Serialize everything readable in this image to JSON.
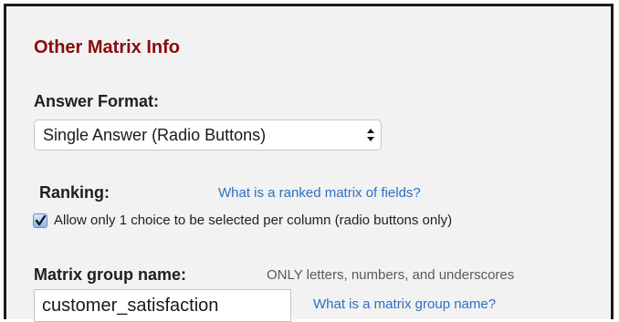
{
  "section": {
    "title": "Other Matrix Info"
  },
  "answer_format": {
    "label": "Answer Format:",
    "selected": "Single Answer (Radio Buttons)",
    "arrows_icon": "up-down-arrows-icon"
  },
  "ranking": {
    "label": "Ranking:",
    "help_link": "What is a ranked matrix of fields?",
    "checkbox_checked": true,
    "checkbox_label": "Allow only 1 choice to be selected per column (radio buttons only)"
  },
  "matrix_group": {
    "label": "Matrix group name:",
    "hint": "ONLY letters, numbers, and underscores",
    "value": "customer_satisfaction",
    "help_link": "What is a matrix group name?"
  },
  "colors": {
    "title": "#8b0a0a",
    "link": "#2a70c2",
    "background": "#f2f2f2"
  }
}
